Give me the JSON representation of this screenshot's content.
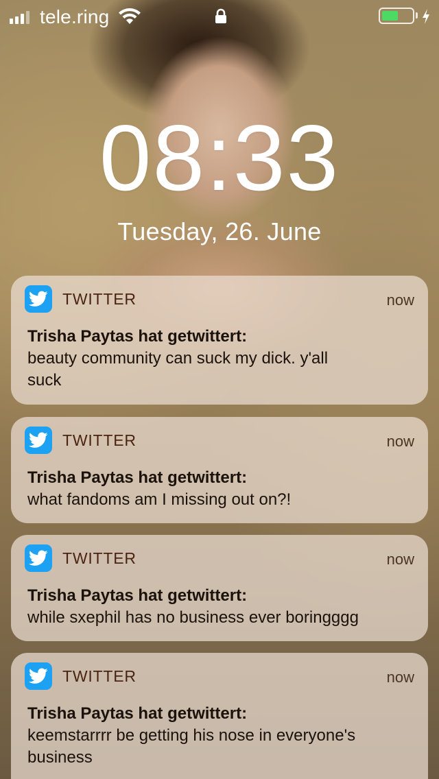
{
  "status_bar": {
    "carrier": "tele.ring",
    "battery_level": 0.55,
    "colors": {
      "battery_fill": "#4cd964"
    }
  },
  "lock_screen": {
    "time": "08:33",
    "date": "Tuesday, 26. June"
  },
  "notifications": [
    {
      "app": "TWITTER",
      "time": "now",
      "title": "Trisha Paytas hat getwittert:",
      "body_lines": [
        "beauty community can suck my dick. y'all",
        "suck"
      ]
    },
    {
      "app": "TWITTER",
      "time": "now",
      "title": "Trisha Paytas hat getwittert:",
      "body_lines": [
        "what fandoms am I missing out on?!"
      ]
    },
    {
      "app": "TWITTER",
      "time": "now",
      "title": "Trisha Paytas hat getwittert:",
      "body_lines": [
        "while sxephil has no business ever boringggg"
      ]
    },
    {
      "app": "TWITTER",
      "time": "now",
      "title": "Trisha Paytas hat getwittert:",
      "body_lines": [
        "keemstarrrr be getting his nose in everyone's",
        "business"
      ]
    }
  ],
  "icons": {
    "app_icon": "twitter-bird-icon",
    "status": [
      "signal-icon",
      "wifi-icon",
      "lock-icon",
      "battery-icon",
      "charging-bolt-icon"
    ]
  },
  "colors": {
    "twitter_blue": "#1da1f2"
  }
}
